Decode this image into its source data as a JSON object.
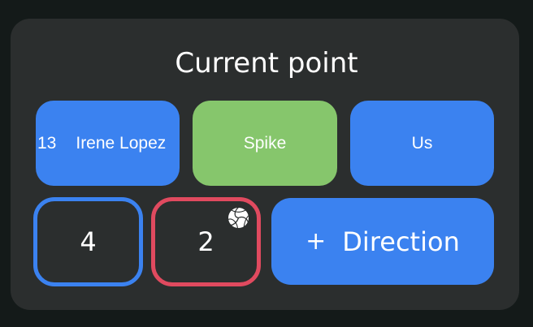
{
  "panel": {
    "title": "Current point"
  },
  "player": {
    "number": "13",
    "name": "Irene Lopez"
  },
  "action": {
    "label": "Spike"
  },
  "team": {
    "label": "Us"
  },
  "score": {
    "us": "4",
    "them": "2",
    "serving_icon": "volleyball-icon"
  },
  "direction_button": {
    "plus": "+",
    "label": "Direction"
  },
  "colors": {
    "background": "#141a19",
    "panel": "#2b2e2e",
    "primary_blue": "#3b82f0",
    "action_green": "#86c66c",
    "opponent_red": "#e04a5f"
  }
}
